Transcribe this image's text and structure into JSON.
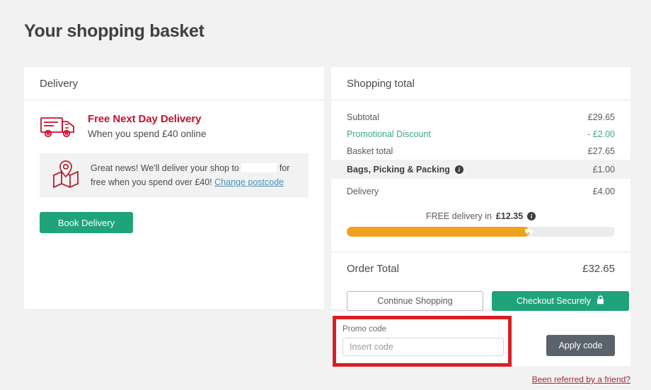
{
  "page": {
    "title": "Your shopping basket"
  },
  "delivery": {
    "header": "Delivery",
    "truck_icon": "delivery-truck-icon",
    "promo_heading": "Free Next Day Delivery",
    "promo_sub": "When you spend £40 online",
    "map_icon": "map-pin-icon",
    "notice_part1": "Great news! We'll deliver your shop to",
    "notice_redacted": "",
    "notice_part2": "for free when you spend over £40!",
    "change_postcode_link": "Change postcode",
    "book_button": "Book Delivery"
  },
  "totals": {
    "header": "Shopping total",
    "rows": [
      {
        "label": "Subtotal",
        "value": "£29.65"
      },
      {
        "label": "Promotional Discount",
        "value": "- £2.00"
      },
      {
        "label": "Basket total",
        "value": "£27.65"
      },
      {
        "label": "Bags, Picking & Packing",
        "value": "£1.00",
        "info_icon": "info-icon"
      },
      {
        "label": "Delivery",
        "value": "£4.00"
      }
    ],
    "progress": {
      "caption_prefix": "FREE delivery in",
      "caption_amount": "£12.35",
      "info_icon": "info-icon",
      "percent": 68,
      "marker_icon": "delivery-van-icon",
      "fill_color": "#efa01e",
      "track_color": "#ececec"
    },
    "order_total_label": "Order Total",
    "order_total_value": "£32.65",
    "continue_button": "Continue Shopping",
    "checkout_button": "Checkout Securely",
    "checkout_icon": "padlock-icon"
  },
  "promo": {
    "label": "Promo code",
    "placeholder": "Insert code",
    "value": "",
    "apply_button": "Apply code",
    "highlight_color": "#d61f26"
  },
  "footer": {
    "referral_link": "Been referred by a friend?"
  }
}
